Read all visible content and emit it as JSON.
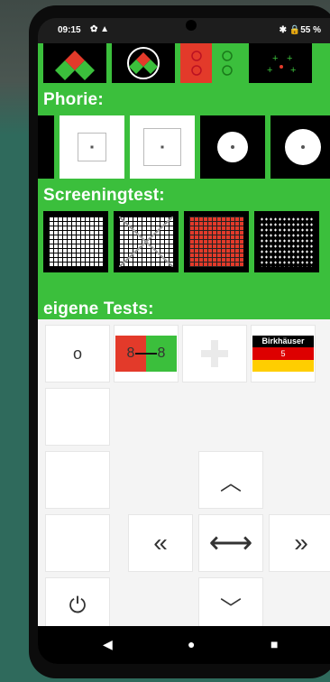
{
  "status_bar": {
    "time": "09:15",
    "left_icons": "✿ ▲",
    "right": "✱ 🔒55 %"
  },
  "sections": {
    "phorie": "Phorie:",
    "screening": "Screeningtest:",
    "own": "eigene Tests:"
  },
  "top_row": [
    {
      "name": "red-green-diamond-icon"
    },
    {
      "name": "circle-diamond-icon"
    },
    {
      "name": "domino-red-green-icon"
    },
    {
      "name": "cross-dots-icon"
    }
  ],
  "phorie_tiles": [
    "box-small-dot",
    "box-dot",
    "circle-large",
    "circle-xlarge"
  ],
  "screening_tiles": [
    "white-grid",
    "x-grid",
    "red-grid",
    "dot-pattern"
  ],
  "own_tests": {
    "circle_label": "o",
    "eight_left": "8",
    "eight_right": "8",
    "birkhaeuser_line1": "Birkhäuser",
    "birkhaeuser_line2": "5"
  },
  "arrows": {
    "up": "︿",
    "down": "﹀",
    "left": "«",
    "right": "»",
    "both": "⟷",
    "power": "⏻"
  },
  "nav": {
    "back": "◀",
    "home": "●",
    "recent": "■"
  },
  "colors": {
    "green": "#3bbf3c",
    "red": "#e33a2a",
    "panel": "#f4f4f4"
  }
}
